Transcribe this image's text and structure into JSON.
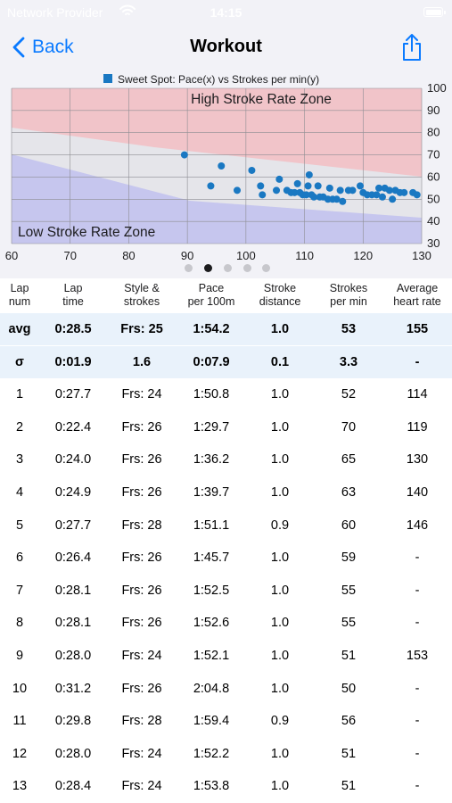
{
  "status_bar": {
    "carrier": "Network Provider",
    "time": "14:15",
    "icons": [
      "wifi-icon",
      "battery-icon"
    ]
  },
  "nav": {
    "back_label": "Back",
    "title": "Workout",
    "share_icon": "share-icon",
    "accent": "#0a7aff"
  },
  "chart_data": {
    "type": "scatter",
    "legend": "Sweet Spot: Pace(x) vs Strokes per min(y)",
    "legend_placement": "top",
    "xlim": [
      60,
      130
    ],
    "ylim": [
      30,
      100
    ],
    "x_ticks": [
      "60",
      "70",
      "80",
      "90",
      "100",
      "110",
      "120",
      "130"
    ],
    "y_ticks": [
      "30",
      "40",
      "50",
      "60",
      "70",
      "80",
      "90",
      "100"
    ],
    "grid": true,
    "zones": [
      {
        "name": "High Stroke Rate Zone",
        "color": "#f1c4c9"
      },
      {
        "name": "Low Stroke Rate Zone",
        "color": "#c6c6ee"
      }
    ],
    "series_color": "#1a78c2",
    "points": [
      {
        "x": 89.5,
        "y": 70
      },
      {
        "x": 94,
        "y": 56
      },
      {
        "x": 95.8,
        "y": 65
      },
      {
        "x": 98.5,
        "y": 54
      },
      {
        "x": 101,
        "y": 63
      },
      {
        "x": 102.5,
        "y": 56
      },
      {
        "x": 102.8,
        "y": 52
      },
      {
        "x": 105.2,
        "y": 54
      },
      {
        "x": 105.7,
        "y": 59
      },
      {
        "x": 107,
        "y": 54
      },
      {
        "x": 107.7,
        "y": 53
      },
      {
        "x": 108.3,
        "y": 53
      },
      {
        "x": 108.8,
        "y": 57
      },
      {
        "x": 109.2,
        "y": 53
      },
      {
        "x": 109.7,
        "y": 52
      },
      {
        "x": 110.3,
        "y": 52
      },
      {
        "x": 110.6,
        "y": 56
      },
      {
        "x": 110.8,
        "y": 61
      },
      {
        "x": 111.2,
        "y": 52
      },
      {
        "x": 111.6,
        "y": 51
      },
      {
        "x": 112.3,
        "y": 56
      },
      {
        "x": 112.6,
        "y": 51
      },
      {
        "x": 113.2,
        "y": 51
      },
      {
        "x": 114,
        "y": 50
      },
      {
        "x": 114.3,
        "y": 55
      },
      {
        "x": 114.8,
        "y": 50
      },
      {
        "x": 115.5,
        "y": 50
      },
      {
        "x": 116.1,
        "y": 54
      },
      {
        "x": 116.5,
        "y": 49
      },
      {
        "x": 117.5,
        "y": 54
      },
      {
        "x": 118.2,
        "y": 54
      },
      {
        "x": 119.5,
        "y": 56
      },
      {
        "x": 120,
        "y": 53
      },
      {
        "x": 120.7,
        "y": 52
      },
      {
        "x": 121.5,
        "y": 52
      },
      {
        "x": 122.3,
        "y": 52
      },
      {
        "x": 122.7,
        "y": 55
      },
      {
        "x": 123.3,
        "y": 51
      },
      {
        "x": 123.7,
        "y": 55
      },
      {
        "x": 124.5,
        "y": 54
      },
      {
        "x": 125,
        "y": 50
      },
      {
        "x": 125.5,
        "y": 54
      },
      {
        "x": 126.3,
        "y": 53
      },
      {
        "x": 127,
        "y": 53
      },
      {
        "x": 128.5,
        "y": 53
      },
      {
        "x": 129.2,
        "y": 52
      }
    ]
  },
  "pager": {
    "count": 5,
    "active": 1
  },
  "table": {
    "headers": [
      {
        "line1": "Lap",
        "line2": "num"
      },
      {
        "line1": "Lap",
        "line2": "time"
      },
      {
        "line1": "Style &",
        "line2": "strokes"
      },
      {
        "line1": "Pace",
        "line2": "per 100m"
      },
      {
        "line1": "Stroke",
        "line2": "distance"
      },
      {
        "line1": "Strokes",
        "line2": "per min"
      },
      {
        "line1": "Average",
        "line2": "heart rate"
      }
    ],
    "summary_rows": [
      [
        "avg",
        "0:28.5",
        "Frs: 25",
        "1:54.2",
        "1.0",
        "53",
        "155"
      ],
      [
        "σ",
        "0:01.9",
        "1.6",
        "0:07.9",
        "0.1",
        "3.3",
        "-"
      ]
    ],
    "rows": [
      [
        "1",
        "0:27.7",
        "Frs: 24",
        "1:50.8",
        "1.0",
        "52",
        "114"
      ],
      [
        "2",
        "0:22.4",
        "Frs: 26",
        "1:29.7",
        "1.0",
        "70",
        "119"
      ],
      [
        "3",
        "0:24.0",
        "Frs: 26",
        "1:36.2",
        "1.0",
        "65",
        "130"
      ],
      [
        "4",
        "0:24.9",
        "Frs: 26",
        "1:39.7",
        "1.0",
        "63",
        "140"
      ],
      [
        "5",
        "0:27.7",
        "Frs: 28",
        "1:51.1",
        "0.9",
        "60",
        "146"
      ],
      [
        "6",
        "0:26.4",
        "Frs: 26",
        "1:45.7",
        "1.0",
        "59",
        "-"
      ],
      [
        "7",
        "0:28.1",
        "Frs: 26",
        "1:52.5",
        "1.0",
        "55",
        "-"
      ],
      [
        "8",
        "0:28.1",
        "Frs: 26",
        "1:52.6",
        "1.0",
        "55",
        "-"
      ],
      [
        "9",
        "0:28.0",
        "Frs: 24",
        "1:52.1",
        "1.0",
        "51",
        "153"
      ],
      [
        "10",
        "0:31.2",
        "Frs: 26",
        "2:04.8",
        "1.0",
        "50",
        "-"
      ],
      [
        "11",
        "0:29.8",
        "Frs: 28",
        "1:59.4",
        "0.9",
        "56",
        "-"
      ],
      [
        "12",
        "0:28.0",
        "Frs: 24",
        "1:52.2",
        "1.0",
        "51",
        "-"
      ],
      [
        "13",
        "0:28.4",
        "Frs: 24",
        "1:53.8",
        "1.0",
        "51",
        "-"
      ]
    ]
  }
}
